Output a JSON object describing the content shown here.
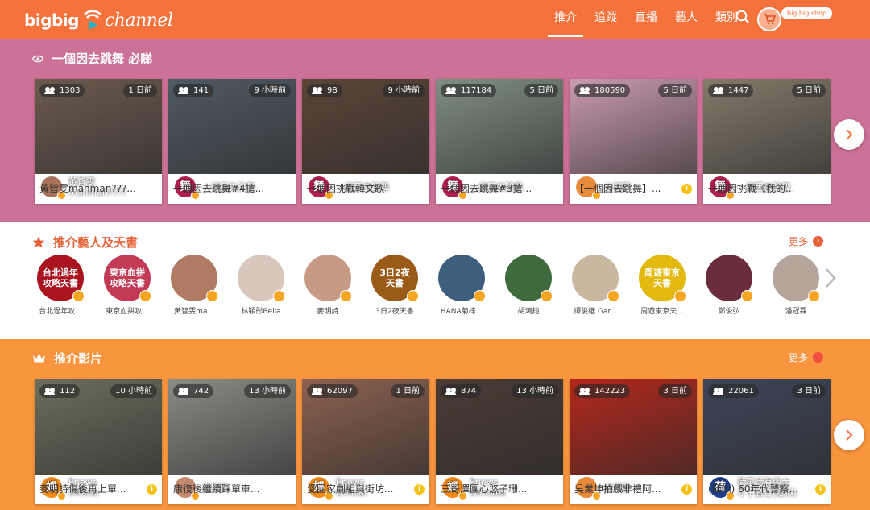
{
  "header": {
    "logo_left": "bigbig",
    "logo_right": "channel",
    "nav": [
      "推介",
      "追蹤",
      "直播",
      "藝人",
      "類別"
    ],
    "shop_label": "big big shop"
  },
  "section1": {
    "title": "一個因去跳舞 必睇",
    "cards": [
      {
        "views": "1303",
        "time": "1 日前",
        "channel": "黃智雯\nmanman????",
        "caption": "黃智雯manman???...",
        "bg": "#6b5a4e",
        "avatar_text": "",
        "avatar_bg": "#a9725b",
        "info": false
      },
      {
        "views": "141",
        "time": "9 小時前",
        "channel": "一個因去跳舞",
        "caption": "一個因去跳舞#4搶...",
        "bg": "#4f5a62",
        "avatar_text": "舞",
        "avatar_bg": "#b01f4f",
        "info": false
      },
      {
        "views": "98",
        "time": "9 小時前",
        "channel": "一個因去跳舞",
        "caption": "一個因挑戰韓文歌",
        "bg": "#5a4538",
        "avatar_text": "舞",
        "avatar_bg": "#b01f4f",
        "info": false
      },
      {
        "views": "117184",
        "time": "5 日前",
        "channel": "一個因去跳舞",
        "caption": "一個因去跳舞#3搶...",
        "bg": "#7f8f83",
        "avatar_text": "舞",
        "avatar_bg": "#b01f4f",
        "info": false
      },
      {
        "views": "180590",
        "time": "5 日前",
        "channel": "大明猩",
        "caption": "【一個因去跳舞】...",
        "bg": "#c99bb0",
        "avatar_text": "",
        "avatar_bg": "#e88a3c",
        "info": true
      },
      {
        "views": "1447",
        "time": "5 日前",
        "channel": "一個因去跳舞",
        "caption": "一個因挑戰《我的...",
        "bg": "#837a6a",
        "avatar_text": "舞",
        "avatar_bg": "#b01f4f",
        "info": false
      }
    ]
  },
  "section2": {
    "title": "推介藝人及天書",
    "more": "更多",
    "artists": [
      {
        "name": "台北過年攻...",
        "text": "台北過年\n攻略天書",
        "bg": "#a9141e"
      },
      {
        "name": "東京血拼攻...",
        "text": "東京血拼\n攻略天書",
        "bg": "#c33a57"
      },
      {
        "name": "黃智雯ma...",
        "text": "",
        "bg": "#b07a63"
      },
      {
        "name": "林穎彤Bella",
        "text": "",
        "bg": "#d9c6bd"
      },
      {
        "name": "麥明詩",
        "text": "",
        "bg": "#c79a85"
      },
      {
        "name": "3日2夜天書",
        "text": "3日2夜\n天書",
        "bg": "#9a5a18"
      },
      {
        "name": "HANA菊梓...",
        "text": "",
        "bg": "#3d5f7d"
      },
      {
        "name": "胡鴻鈞",
        "text": "",
        "bg": "#3f6a3d"
      },
      {
        "name": "譚俊權 Gar...",
        "text": "",
        "bg": "#c9b7a0"
      },
      {
        "name": "周遊東京天...",
        "text": "周遊東京\n天書",
        "bg": "#e3b80f"
      },
      {
        "name": "鄭俊弘",
        "text": "",
        "bg": "#6b2d3d"
      },
      {
        "name": "潘冠霖",
        "text": "",
        "bg": "#b5a59a"
      }
    ]
  },
  "section3": {
    "title": "推介影片",
    "more": "更多",
    "cards": [
      {
        "views": "112",
        "time": "10 小時前",
        "channel": "Enews\nOfficial",
        "caption": "麥明詩傷後再上單...",
        "bg": "#6d6e5c",
        "avatar_text": "娛",
        "avatar_bg": "#f28c1e",
        "info": true
      },
      {
        "views": "742",
        "time": "13 小時前",
        "channel": "麥明詩",
        "caption": "康復後繼續踩單車...",
        "bg": "#8a8b86",
        "avatar_text": "",
        "avatar_bg": "#c38a6d",
        "info": false
      },
      {
        "views": "62097",
        "time": "1 日前",
        "channel": "Enews\nOfficial",
        "caption": "愛回家劇組與街坊...",
        "bg": "#8c6150",
        "avatar_text": "娛",
        "avatar_bg": "#f28c1e",
        "info": true
      },
      {
        "views": "874",
        "time": "13 小時前",
        "channel": "Enews\nOfficial2",
        "caption": "三哥澤團心悠子珊...",
        "bg": "#4b3b33",
        "avatar_text": "娛",
        "avatar_bg": "#f28c1e",
        "info": false
      },
      {
        "views": "142223",
        "time": "3 日前",
        "channel": "大明猩",
        "caption": "吳業坤拍戲非禮阿...",
        "bg": "#b3271c",
        "avatar_text": "",
        "avatar_bg": "#e88a3c",
        "info": true
      },
      {
        "views": "22061",
        "time": "3 日前",
        "channel": "荷里活有個大\n才子廣告(疑似)",
        "caption": "(疑似) 60年代警察...",
        "bg": "#3d4658",
        "avatar_text": "荷",
        "avatar_bg": "#1e3f8a",
        "info": true
      }
    ]
  },
  "colors": {
    "header": "#f6723c",
    "section1_bg": "#cc7197",
    "section3_bg": "#f8953e",
    "accent": "#e5623a"
  }
}
